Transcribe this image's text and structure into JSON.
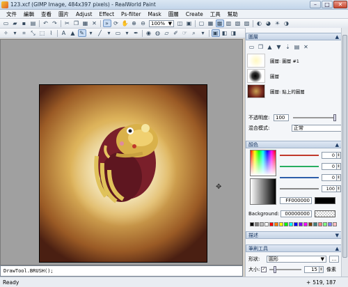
{
  "window": {
    "title": "123.xcf (GIMP Image, 484x397 pixels) - RealWorld Paint",
    "minimize": "–",
    "maximize": "□",
    "close": "✕"
  },
  "menu": [
    "文件",
    "編輯",
    "查看",
    "圖片",
    "Adjust",
    "Effect",
    "Ps-filter",
    "Mask",
    "圖層",
    "Create",
    "工具",
    "幫助"
  ],
  "toolbar": {
    "zoom_value": "100%",
    "zoom_arrow": "▼"
  },
  "canvas": {
    "move_cursor_glyph": "✥"
  },
  "scripting": {
    "text": "DrawTool.BRUSH();"
  },
  "status": {
    "left": "Ready",
    "coords": "519, 187"
  },
  "layers_panel": {
    "title": "圖層",
    "toggle": "▲",
    "layers": [
      {
        "name": "圖層: 圖層 #1"
      },
      {
        "name": "圖層"
      },
      {
        "name": "圖層: 貼上的圖層"
      }
    ],
    "opacity_label": "不透明度:",
    "opacity_value": "100",
    "blend_label": "混合模式:",
    "blend_value": "正常",
    "dropdown_arrow": "▼"
  },
  "color_panel": {
    "title": "顏色",
    "toggle": "▲",
    "channels": [
      {
        "value": "0",
        "color": "#c0392b"
      },
      {
        "value": "0",
        "color": "#27ae60"
      },
      {
        "value": "0",
        "color": "#2e5eaa"
      },
      {
        "value": "100",
        "color": "#888888"
      }
    ],
    "hex_value": "FF000000",
    "background_label": "Background:",
    "background_value": "00000000",
    "palette": [
      "#000000",
      "#7f7f7f",
      "#c0c0c0",
      "#ffffff",
      "#ff0000",
      "#ff8000",
      "#ffff00",
      "#00ff00",
      "#00ffff",
      "#0000ff",
      "#8000ff",
      "#ff00ff",
      "#804000",
      "#408080",
      "#ff8080",
      "#80ff80",
      "#8080ff",
      "#ffc0c0"
    ]
  },
  "collapsed_panel": {
    "title": "描述",
    "toggle": "▼"
  },
  "brush_panel": {
    "title": "筆刷工具",
    "toggle": "▲",
    "shape_label": "形狀:",
    "shape_value": "圓形",
    "more_button": "...",
    "size_label": "大小:",
    "size_value": "15",
    "size_unit": "像素"
  }
}
